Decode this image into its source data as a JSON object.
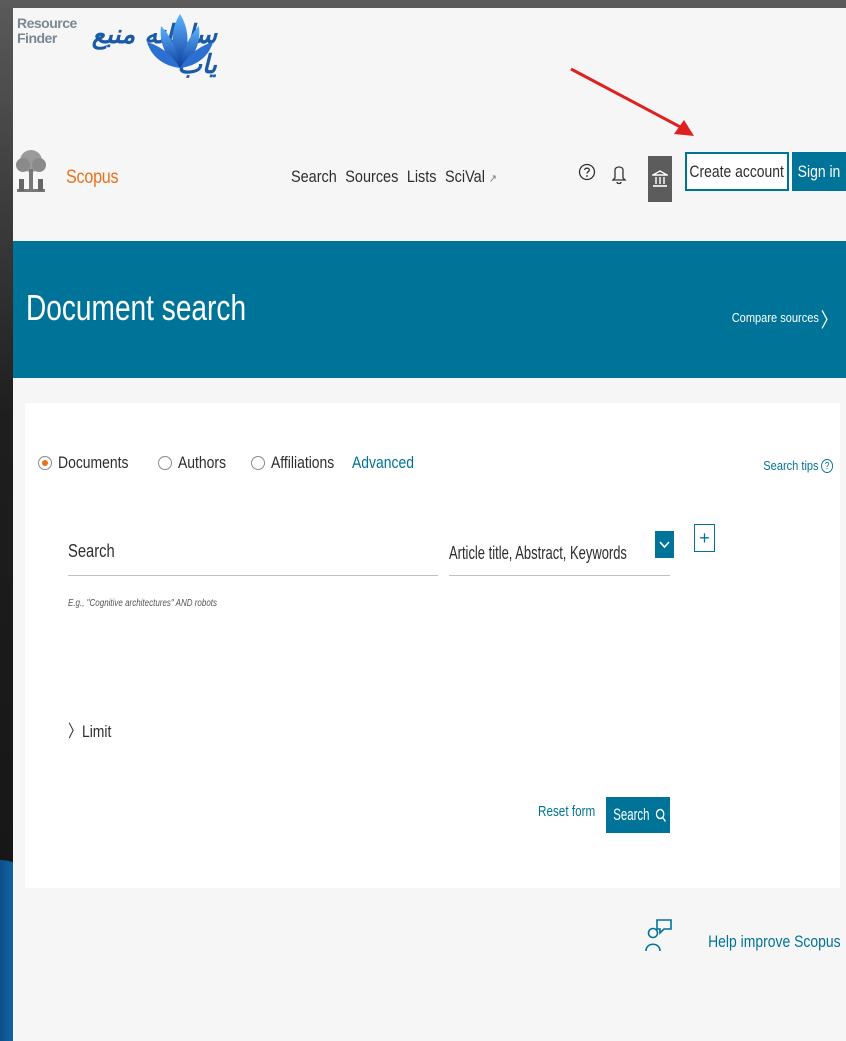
{
  "logo": {
    "english": [
      "Resource",
      "Finder"
    ],
    "persian": "سامانه منبع یاب"
  },
  "header": {
    "brand": "Scopus",
    "nav": [
      {
        "label": "Search"
      },
      {
        "label": "Sources"
      },
      {
        "label": "Lists"
      },
      {
        "label": "SciVal",
        "ext": "↗"
      }
    ],
    "create_account": "Create account",
    "sign_in": "Sign in"
  },
  "banner": {
    "title": "Document search",
    "compare": "Compare sources",
    "compare_chev": "〉"
  },
  "search": {
    "tabs": [
      {
        "label": "Documents",
        "selected": true
      },
      {
        "label": "Authors",
        "selected": false
      },
      {
        "label": "Affiliations",
        "selected": false
      }
    ],
    "advanced": "Advanced",
    "tips": "Search tips",
    "tips_icon": "?",
    "placeholder": "Search",
    "field": "Article title, Abstract, Keywords",
    "add": "+",
    "example": "E.g., \"Cognitive architectures\" AND robots",
    "limit": "〉Limit",
    "reset": "Reset form",
    "search_button": "Search"
  },
  "help": {
    "text": "Help improve Scopus"
  },
  "colors": {
    "accent": "#007398",
    "brand": "#e9711c",
    "annotation_arrow": "#e02020"
  }
}
